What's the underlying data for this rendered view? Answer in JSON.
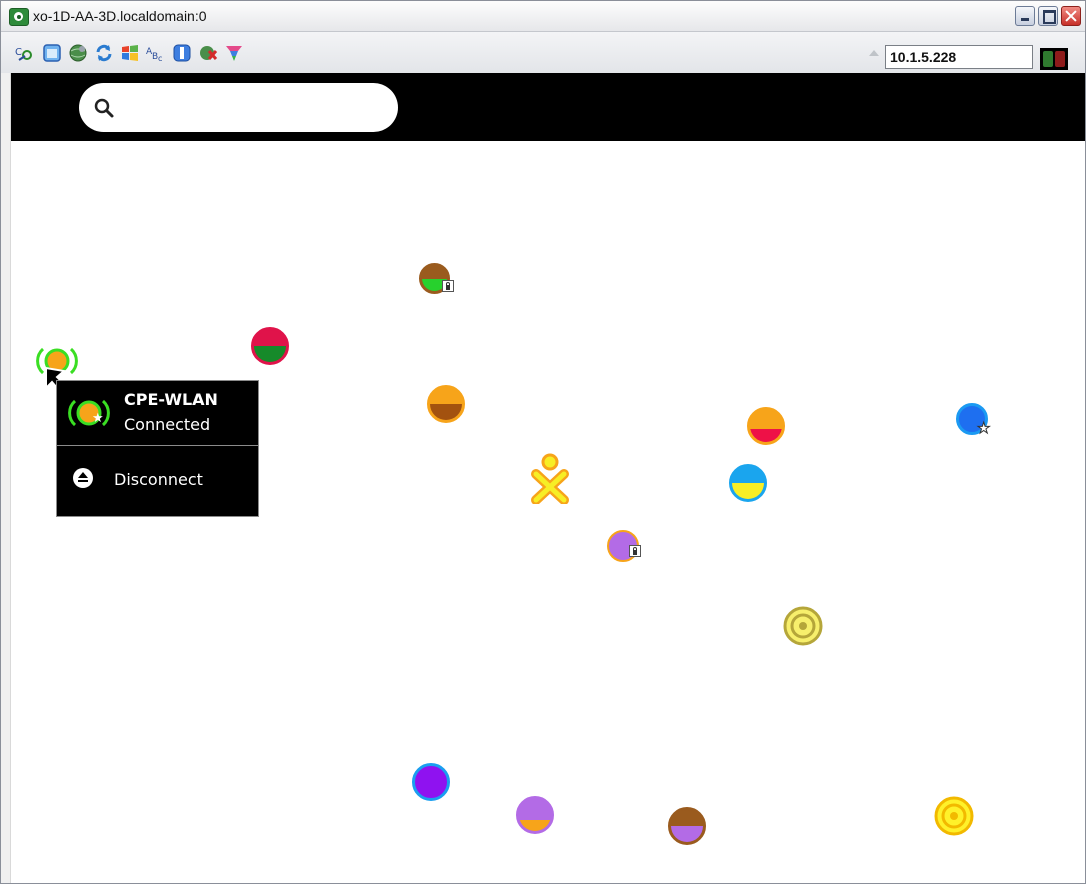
{
  "window": {
    "title": "xo-1D-AA-3D.localdomain:0",
    "controls": [
      "minimize",
      "maximize",
      "close"
    ]
  },
  "toolbar": {
    "icons": [
      "options-icon",
      "fullscreen-icon",
      "globe-icon",
      "refresh-icon",
      "windows-icon",
      "font-icon",
      "transfer-icon",
      "disconnect-icon",
      "color-icon"
    ],
    "address": "10.1.5.228",
    "status_colors": [
      "#2f7a2f",
      "#8e1b1b"
    ]
  },
  "frame": {
    "search_value": "",
    "search_placeholder": ""
  },
  "palette": {
    "network_name": "CPE-WLAN",
    "status": "Connected",
    "action_label": "Disconnect",
    "icon_colors": {
      "fill": "#f7a41a",
      "stroke": "#3ade23"
    }
  },
  "networks": [
    {
      "id": "selected",
      "top": "#f7a41a",
      "bottom": "#f7a41a",
      "stroke": "#3ade23",
      "badge": "star",
      "connected": true
    },
    {
      "id": "n-brown-green-lock",
      "top": "#9a5b1e",
      "bottom": "#27d12d",
      "stroke": "#9a5b1e",
      "badge": "lock"
    },
    {
      "id": "n-red-green",
      "top": "#e0134a",
      "bottom": "#168a2a",
      "stroke": "#e0134a",
      "badge": ""
    },
    {
      "id": "n-orange-brown",
      "top": "#f7a41a",
      "bottom": "#a3520f",
      "stroke": "#f7a41a",
      "badge": ""
    },
    {
      "id": "n-orange-red",
      "top": "#f7a41a",
      "bottom": "#ee1147",
      "stroke": "#f7a41a",
      "badge": ""
    },
    {
      "id": "n-blue-star",
      "top": "#1e6ff0",
      "bottom": "#1e6ff0",
      "stroke": "#1b9af2",
      "badge": "star"
    },
    {
      "id": "n-cyan-yellow",
      "top": "#1aa5ee",
      "bottom": "#f7ee25",
      "stroke": "#1aa5ee",
      "badge": ""
    },
    {
      "id": "n-purple-lock",
      "top": "#b36be6",
      "bottom": "#b36be6",
      "stroke": "#f7a41a",
      "badge": "lock"
    },
    {
      "id": "n-purple-blue",
      "top": "#8f12f0",
      "bottom": "#8f12f0",
      "stroke": "#1a9ef0",
      "badge": ""
    },
    {
      "id": "n-purple-orange",
      "top": "#b36be6",
      "bottom": "#f7a41a",
      "stroke": "#b36be6",
      "badge": ""
    },
    {
      "id": "n-brown-purple",
      "top": "#9a5b1e",
      "bottom": "#b36be6",
      "stroke": "#9a5b1e",
      "badge": ""
    }
  ],
  "mesh_points": [
    {
      "id": "mesh-1",
      "fill": "#f7ef6c",
      "stroke": "#b5a63a"
    },
    {
      "id": "mesh-2",
      "fill": "#fff12a",
      "stroke": "#f2b900"
    }
  ],
  "xo_icon": {
    "fill": "#f7ee25",
    "stroke": "#f7a41a"
  }
}
